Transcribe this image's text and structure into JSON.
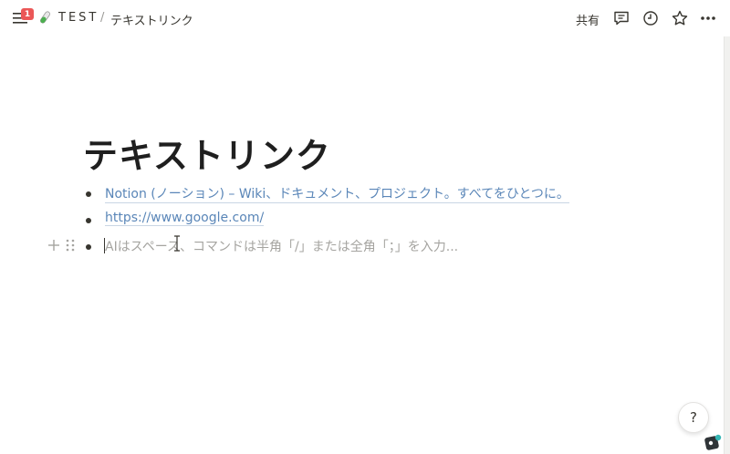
{
  "topbar": {
    "notification_count": "1",
    "workspace": "TEST",
    "separator": "/",
    "page": "テキストリンク",
    "share_label": "共有"
  },
  "icons": {
    "menu": "menu-icon",
    "page_icon": "test-tube-icon",
    "comments": "comment-icon",
    "updates": "clock-icon",
    "favorite": "star-icon",
    "more": "more-icon",
    "add_block": "plus-icon",
    "drag": "drag-handle-icon",
    "help": "help-icon",
    "logo": "app-logo-icon"
  },
  "page": {
    "title": "テキストリンク",
    "blocks": [
      {
        "type": "link",
        "text": "Notion (ノーション) – Wiki、ドキュメント、プロジェクト。すべてをひとつに。"
      },
      {
        "type": "link",
        "text": "https://www.google.com/"
      },
      {
        "type": "placeholder",
        "text": "AIはスペース、コマンドは半角「/」または全角「；」を入力..."
      }
    ]
  },
  "help": {
    "label": "?"
  },
  "colors": {
    "link": "#5a86b8",
    "badge": "#eb5757",
    "placeholder": "#a5a4a0",
    "text": "#37352f"
  }
}
